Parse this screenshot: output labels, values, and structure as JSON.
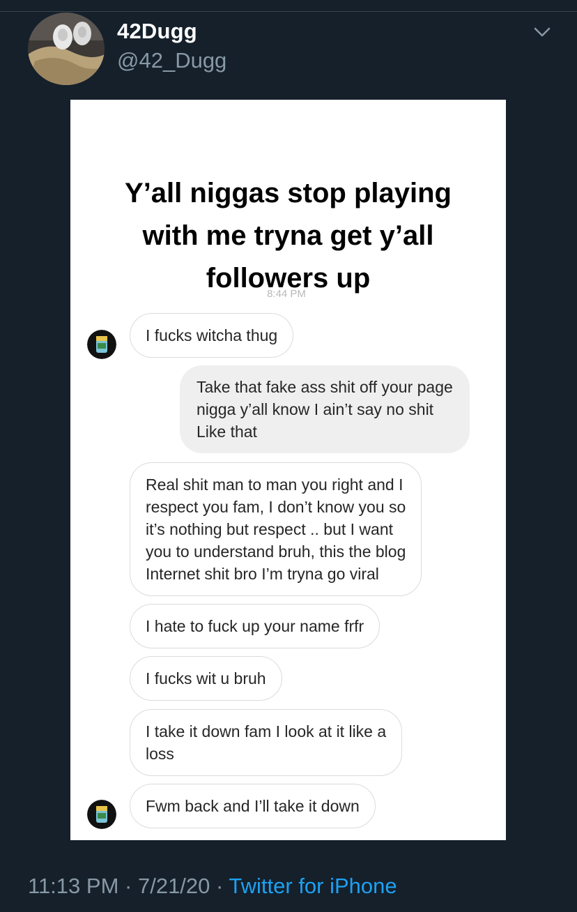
{
  "tweet": {
    "display_name": "42Dugg",
    "handle": "@42_Dugg",
    "caret_icon": "chevron-down-icon",
    "footer": {
      "time": "11:13 PM",
      "separator": "·",
      "date": "7/21/20",
      "source": "Twitter for iPhone"
    }
  },
  "media": {
    "caption_lines": [
      "Y’all niggas stop playing",
      "with me tryna get y’all",
      "followers up"
    ],
    "dm_timestamp": "8:44 PM",
    "messages": [
      {
        "side": "incoming",
        "lines": [
          "I fucks witcha thug"
        ]
      },
      {
        "side": "outgoing",
        "lines": [
          "Take that fake ass shit off your page",
          "nigga y’all know I ain’t say no shit",
          "Like that"
        ]
      },
      {
        "side": "incoming",
        "lines": [
          "Real shit man to man you right and I",
          "respect you fam, I don’t know you so",
          "it’s nothing but respect .. but I want",
          "you to understand bruh, this the blog",
          "Internet shit bro I’m tryna go viral"
        ]
      },
      {
        "side": "incoming",
        "lines": [
          "I hate to fuck up your name frfr"
        ]
      },
      {
        "side": "incoming",
        "lines": [
          "I fucks wit u bruh"
        ]
      },
      {
        "side": "incoming",
        "lines": [
          "I take it down fam I look at it like a",
          "loss"
        ]
      },
      {
        "side": "incoming",
        "lines": [
          "Fwm back and I’ll take it down"
        ]
      }
    ]
  },
  "colors": {
    "background": "#15202b",
    "divider": "#38444d",
    "name": "#ffffff",
    "secondary_text": "#8899a6",
    "link": "#1da1f2",
    "incoming_border": "#dbdbdb",
    "outgoing_fill": "#efefef"
  }
}
